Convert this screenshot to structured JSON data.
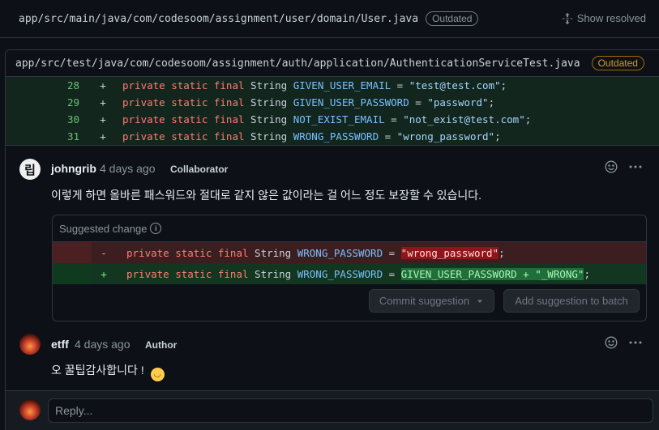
{
  "outdated_file": {
    "path": "app/src/main/java/com/codesoom/assignment/user/domain/User.java",
    "badge": "Outdated",
    "show_resolved": "Show resolved"
  },
  "thread": {
    "path": "app/src/test/java/com/codesoom/assignment/auth/application/AuthenticationServiceTest.java",
    "badge": "Outdated",
    "diff_lines": [
      {
        "num": "28",
        "sign": "+",
        "kw": "private static final",
        "type": "String",
        "var": "GIVEN_USER_EMAIL",
        "op": " = ",
        "str": "\"test@test.com\"",
        "end": ";"
      },
      {
        "num": "29",
        "sign": "+",
        "kw": "private static final",
        "type": "String",
        "var": "GIVEN_USER_PASSWORD",
        "op": " = ",
        "str": "\"password\"",
        "end": ";"
      },
      {
        "num": "30",
        "sign": "+",
        "kw": "private static final",
        "type": "String",
        "var": "NOT_EXIST_EMAIL",
        "op": " = ",
        "str": "\"not_exist@test.com\"",
        "end": ";"
      },
      {
        "num": "31",
        "sign": "+",
        "kw": "private static final",
        "type": "String",
        "var": "WRONG_PASSWORD",
        "op": " = ",
        "str": "\"wrong_password\"",
        "end": ";"
      }
    ]
  },
  "comment1": {
    "avatar_text": "립",
    "author": "johngrib",
    "time": "4 days ago",
    "role": "Collaborator",
    "body": "이렇게 하면 올바른 패스워드와 절대로 같지 않은 값이라는 걸 어느 정도 보장할 수 있습니다.",
    "suggestion": {
      "title": "Suggested change",
      "del": {
        "sign": "-",
        "kw": "private static final",
        "type": "String",
        "var": "WRONG_PASSWORD",
        "op": " = ",
        "hl": "\"wrong_password\"",
        "end": ";"
      },
      "add": {
        "sign": "+",
        "kw": "private static final",
        "type": "String",
        "var": "WRONG_PASSWORD",
        "op": " = ",
        "hl": "GIVEN_USER_PASSWORD + \"_WRONG\"",
        "end": ";"
      },
      "commit_label": "Commit suggestion",
      "batch_label": "Add suggestion to batch"
    }
  },
  "comment2": {
    "author": "etff",
    "time": "4 days ago",
    "role": "Author",
    "body": "오 꿀팁감사합니다 !"
  },
  "reply": {
    "placeholder": "Reply..."
  }
}
